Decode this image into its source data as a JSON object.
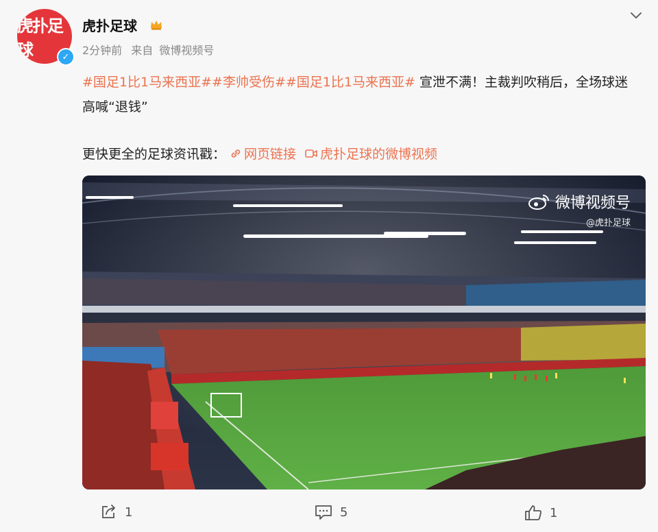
{
  "author": {
    "avatar_text": "虎扑足球",
    "name": "虎扑足球"
  },
  "meta": {
    "time": "2分钟前",
    "source_prefix": "来自",
    "source": "微博视频号"
  },
  "post": {
    "tags": [
      "#国足1比1马来西亚#",
      "#李帅受伤#",
      "#国足1比1马来西亚#"
    ],
    "body": " 宣泄不满！主裁判吹稍后，全场球迷高喊“退钱”",
    "links_prefix": "更快更全的足球资讯戳：",
    "link_web": "网页链接",
    "link_video": "虎扑足球的微博视频"
  },
  "media": {
    "watermark_main": "微博视频号",
    "watermark_sub": "@虎扑足球"
  },
  "actions": {
    "repost_count": "1",
    "comment_count": "5",
    "like_count": "1"
  },
  "colors": {
    "accent": "#eb7350",
    "avatar_bg": "#e4363a",
    "verified": "#2ea7f5"
  }
}
